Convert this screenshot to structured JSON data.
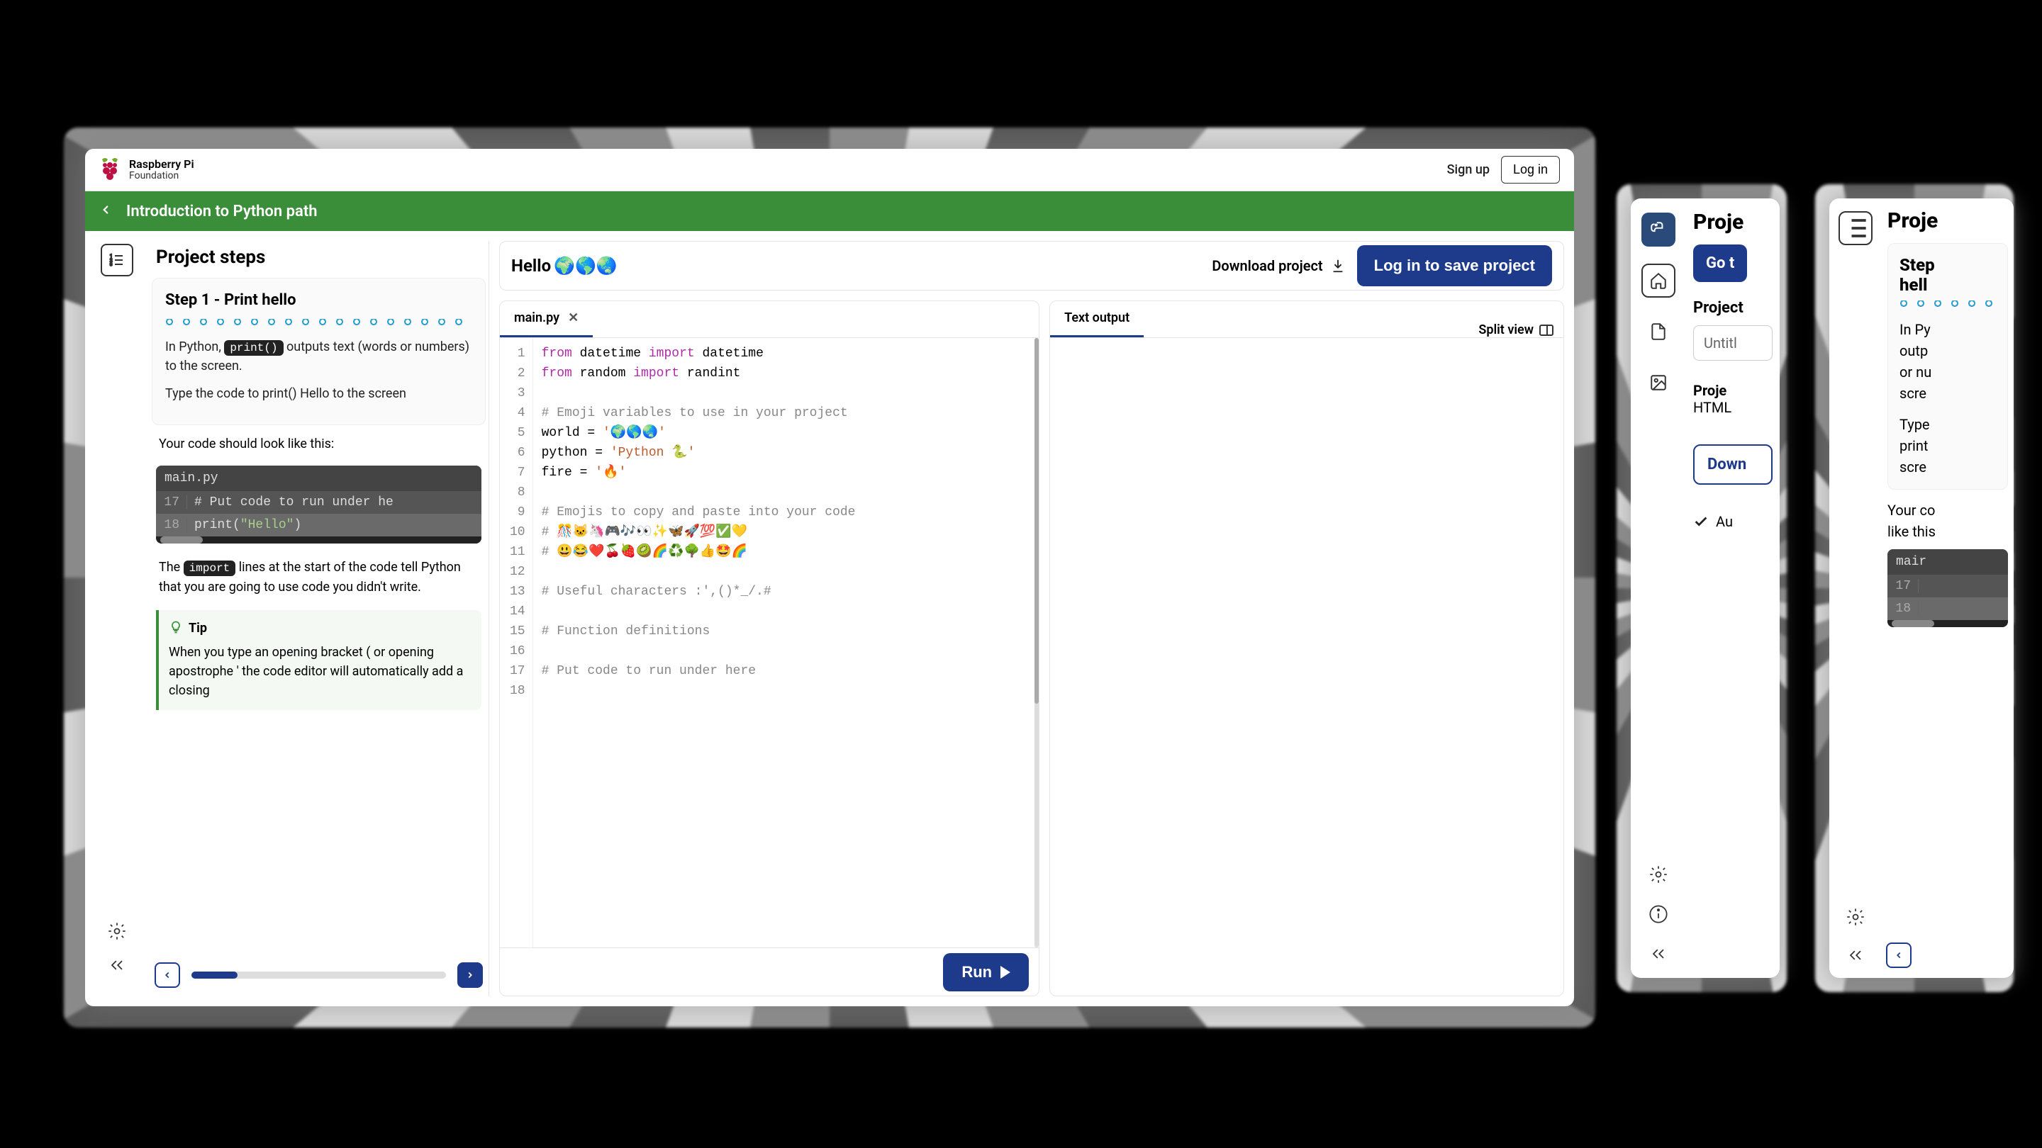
{
  "header": {
    "brand_line1": "Raspberry Pi",
    "brand_line2": "Foundation",
    "signup": "Sign up",
    "login": "Log in"
  },
  "greenbar": {
    "title": "Introduction to Python path"
  },
  "steps": {
    "panel_title": "Project steps",
    "step_title": "Step 1 - Print hello",
    "p1_pre": "In Python, ",
    "p1_code": "print()",
    "p1_post": " outputs text (words or numbers) to the screen.",
    "p2": "Type the code to print() Hello to the screen",
    "note": "Your code should look like this:",
    "mini_tab": "main.py",
    "line17_num": "17",
    "line17": "# Put code to run under he",
    "line18_num": "18",
    "line18_a": "print(",
    "line18_b": "\"Hello\"",
    "line18_c": ")",
    "para_pre": "The ",
    "para_code": "import",
    "para_post": " lines at the start of the code tell Python that you are going to use code you didn't write.",
    "tip_label": "Tip",
    "tip_body": "When you type an opening bracket ( or opening apostrophe ' the code editor will automatically add a closing"
  },
  "title_row": {
    "title": "Hello",
    "emojis": "🌍🌎🌏",
    "download": "Download project",
    "save": "Log in to save project"
  },
  "editor": {
    "tab": "main.py",
    "lines": [
      {
        "n": "1",
        "html": "<span class='kw'>from</span> datetime <span class='kw2'>import</span> datetime"
      },
      {
        "n": "2",
        "html": "<span class='kw'>from</span> random <span class='kw2'>import</span> randint"
      },
      {
        "n": "3",
        "html": ""
      },
      {
        "n": "4",
        "html": "<span class='cm'># Emoji variables to use in your project</span>"
      },
      {
        "n": "5",
        "html": "world = <span class='str'>'🌍🌎🌏'</span>"
      },
      {
        "n": "6",
        "html": "python = <span class='str'>'Python 🐍'</span>"
      },
      {
        "n": "7",
        "html": "fire = <span class='str'>'🔥'</span>"
      },
      {
        "n": "8",
        "html": ""
      },
      {
        "n": "9",
        "html": "<span class='cm'># Emojis to copy and paste into your code</span>"
      },
      {
        "n": "10",
        "html": "<span class='cm'># 🎊🐱🦄🎮🎶👀✨🦋🚀💯✅💛</span>"
      },
      {
        "n": "11",
        "html": "<span class='cm'># 😃😂❤️🍒🍓🥝🌈♻️🌳👍🤩🌈</span>"
      },
      {
        "n": "12",
        "html": ""
      },
      {
        "n": "13",
        "html": "<span class='cm'># Useful characters :',()*_/.#</span>"
      },
      {
        "n": "14",
        "html": ""
      },
      {
        "n": "15",
        "html": "<span class='cm'># Function definitions</span>"
      },
      {
        "n": "16",
        "html": ""
      },
      {
        "n": "17",
        "html": "<span class='cm'># Put code to run under here</span>"
      },
      {
        "n": "18",
        "html": ""
      }
    ],
    "run": "Run"
  },
  "output": {
    "tab": "Text output",
    "split": "Split view"
  },
  "partial2": {
    "heading": "Proje",
    "bluebtn": "Go t",
    "label1": "Project",
    "input": "Untitl",
    "proj_label": "Proje",
    "proj_value": "HTML",
    "download": "Down",
    "autosave": "Au"
  },
  "partial3": {
    "heading": "Proje",
    "step_title": "Step\nhell",
    "p1": "In Py",
    "p2": "outp",
    "p3": "or nu",
    "p4": "scre",
    "t1": "Type",
    "t2": "print",
    "t3": "scre",
    "note1": "Your co",
    "note2": "like this",
    "mini_tab": "mair",
    "n17": "17",
    "n18": "18"
  }
}
